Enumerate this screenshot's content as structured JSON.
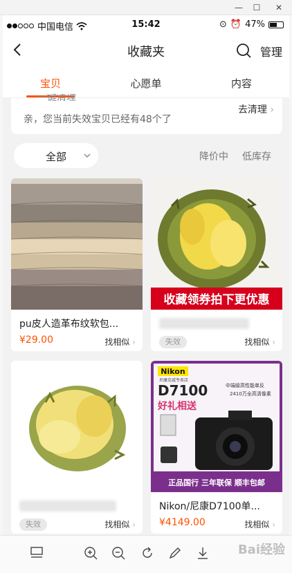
{
  "status_bar": {
    "carrier": "中国电信",
    "time": "15:42",
    "battery": "47%"
  },
  "header": {
    "title": "收藏夹",
    "manage": "管理"
  },
  "tabs": [
    {
      "label": "宝贝",
      "active": true
    },
    {
      "label": "心愿单",
      "active": false
    },
    {
      "label": "内容",
      "active": false
    }
  ],
  "notice": {
    "top_fragment": "一键清理",
    "message": "亲，您当前失效宝贝已经有48个了",
    "action": "去清理"
  },
  "filter": {
    "dropdown": "全部",
    "chips": [
      "降价中",
      "低库存"
    ]
  },
  "products": [
    {
      "name": "pu皮人造革布纹软包...",
      "price": "¥29.00",
      "similar": "找相似"
    },
    {
      "banner": "收藏领券拍下更优惠",
      "badge": "失效",
      "similar": "找相似"
    },
    {
      "badge": "失效",
      "similar": "找相似"
    },
    {
      "name": "Nikon/尼康D7100单...",
      "price": "¥4149.00",
      "similar": "找相似",
      "ad": {
        "brand": "Nikon",
        "brand_sub": "尼康克威专卖店",
        "model": "D7100",
        "slogan": "好礼相送",
        "spec1": "中端级高性能单反",
        "spec2": "2410万全高清像素",
        "footer": "正品国行  三年联保  顺丰包邮"
      }
    }
  ],
  "watermark": "Bai经验",
  "colors": {
    "accent": "#ff5000",
    "ad_purple": "#7b2f8c",
    "banner_red": "#d6001c"
  }
}
